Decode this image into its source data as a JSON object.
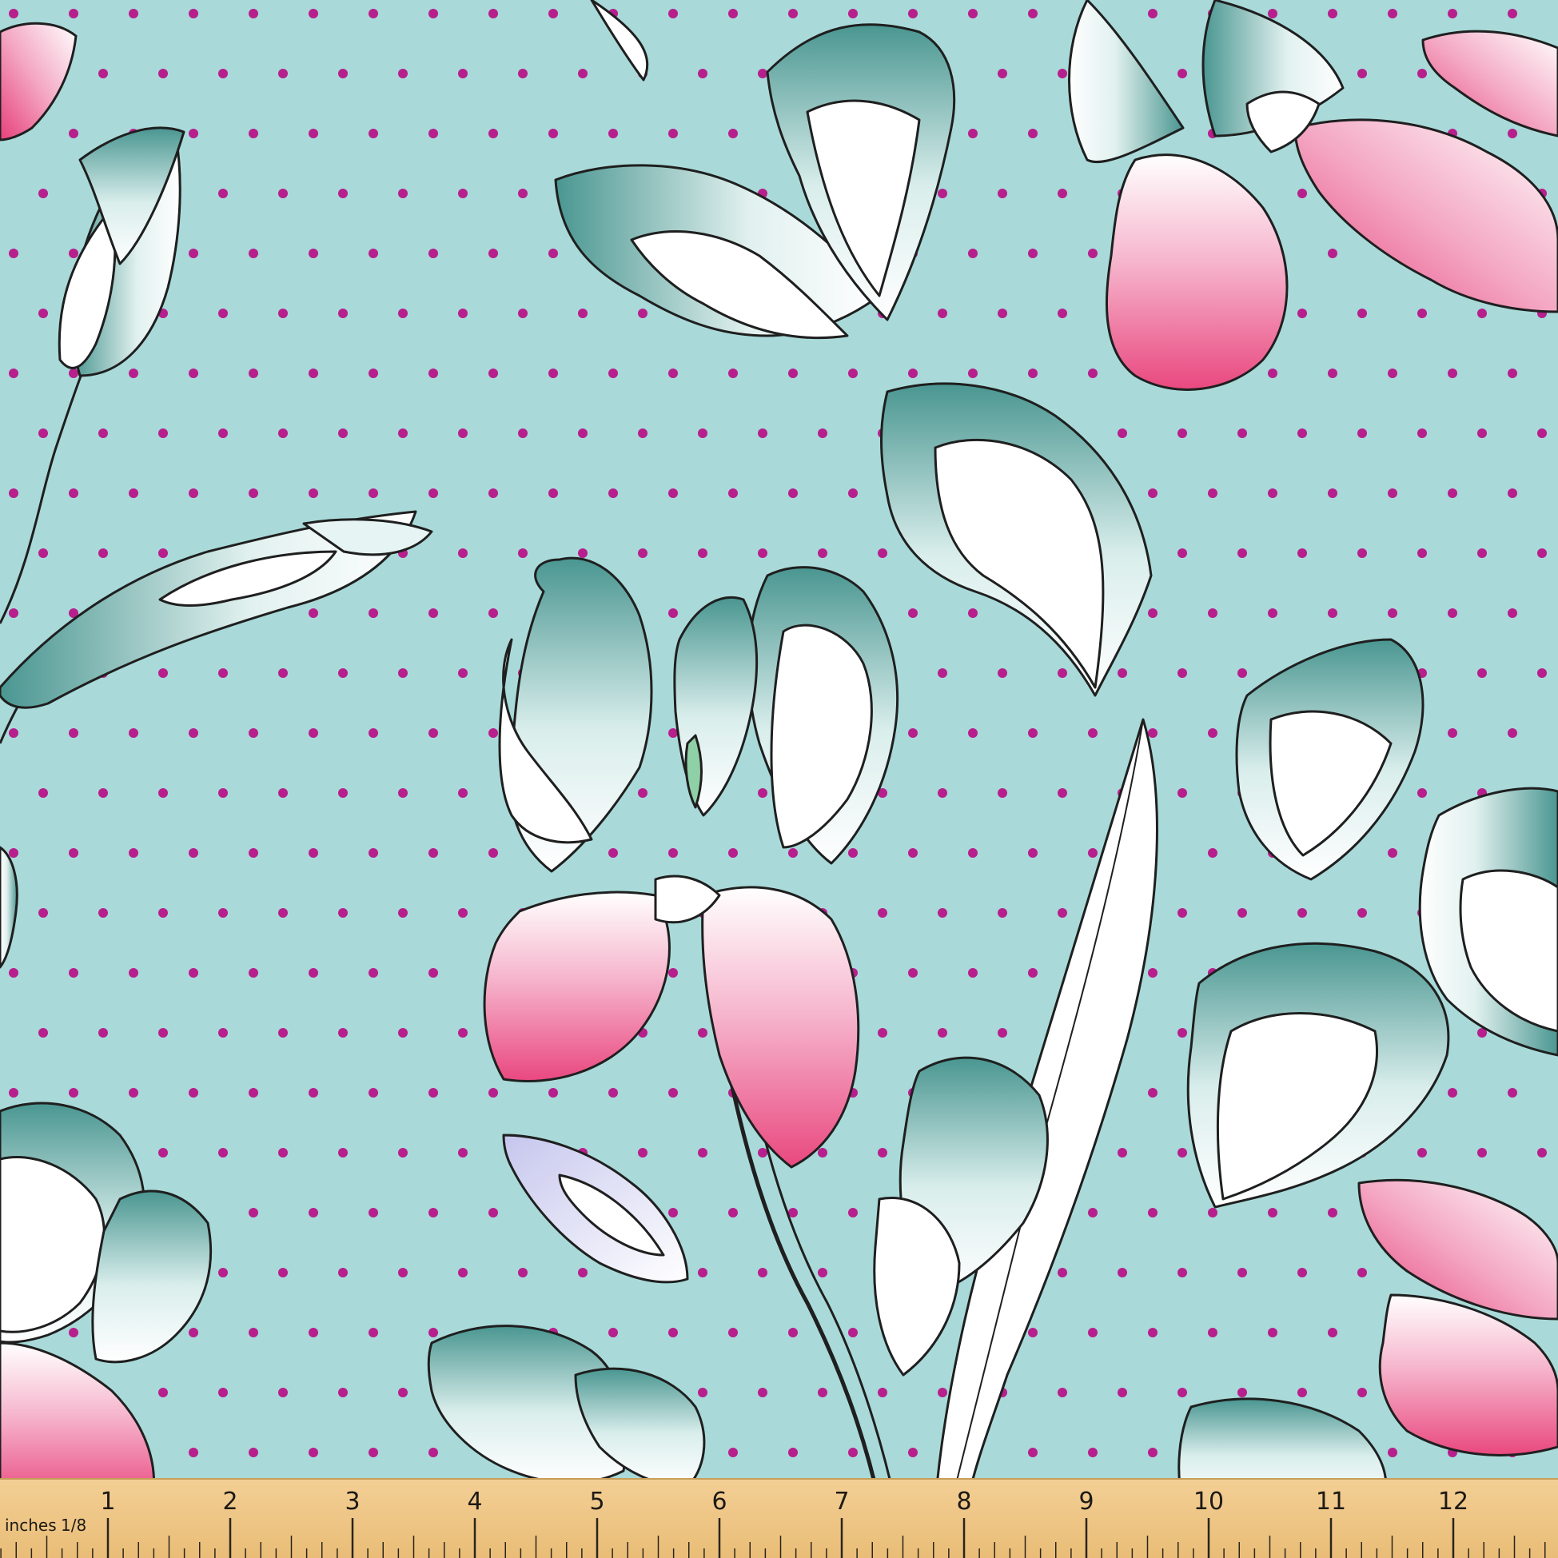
{
  "fabric": {
    "background_color": "#a9dad9",
    "dot_color": "#b61f8c",
    "petal_pink": "#ea4d86",
    "petal_teal": "#4d9c97",
    "petal_white": "#ffffff",
    "outline_color": "#1f1f1f"
  },
  "ruler": {
    "color": "#f0c98b",
    "unit_label": "inches",
    "fraction_label": "1/8",
    "numbers": [
      "1",
      "2",
      "3",
      "4",
      "5",
      "6",
      "7",
      "8",
      "9",
      "10",
      "11",
      "12",
      "1"
    ]
  }
}
